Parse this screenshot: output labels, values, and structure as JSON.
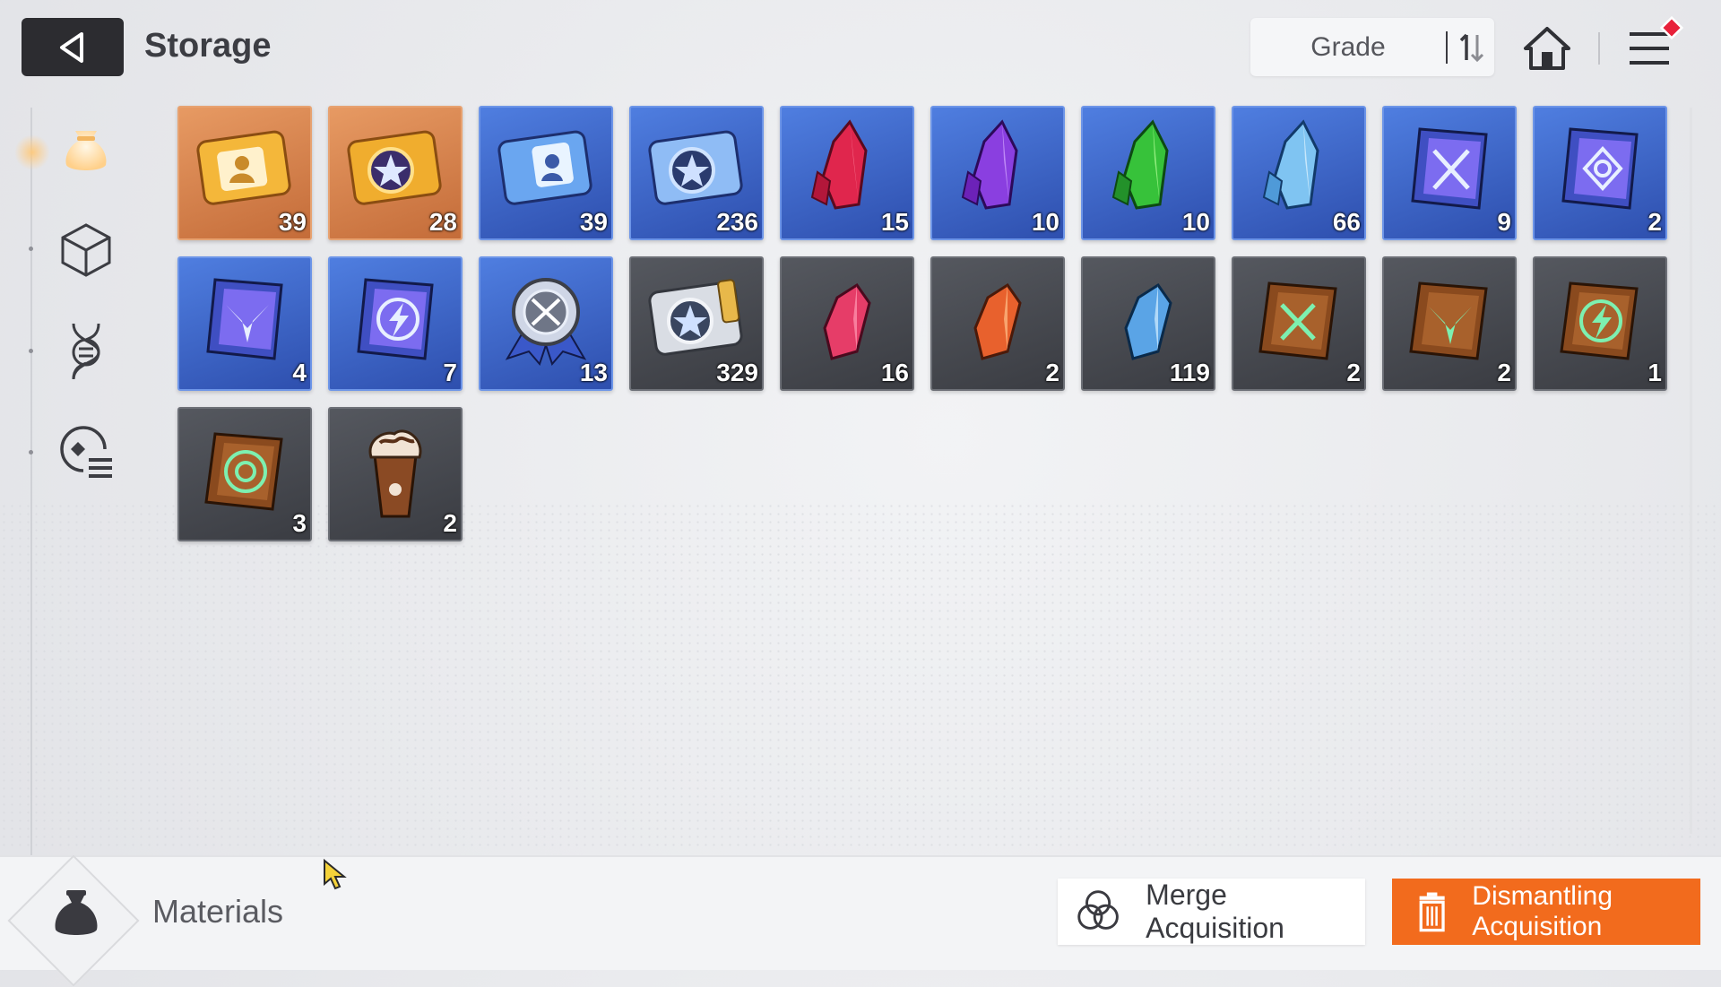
{
  "header": {
    "title": "Storage",
    "sort_label": "Grade"
  },
  "colors": {
    "accent": "#f26b1d",
    "notification": "#e8213a",
    "tile_orange": "#d98250",
    "tile_blue": "#3d66c9",
    "tile_gray": "#484a50"
  },
  "sidebar": {
    "tabs": [
      {
        "icon": "material-bag-icon",
        "active": true
      },
      {
        "icon": "cube-icon",
        "active": false
      },
      {
        "icon": "dna-icon",
        "active": false
      },
      {
        "icon": "character-list-icon",
        "active": false
      }
    ]
  },
  "items": [
    {
      "icon": "gold-character-ticket-icon",
      "qty": "39"
    },
    {
      "icon": "gold-star-ticket-icon",
      "qty": "28"
    },
    {
      "icon": "blue-character-ticket-icon",
      "qty": "39"
    },
    {
      "icon": "blue-star-ticket-icon",
      "qty": "236"
    },
    {
      "icon": "red-crystal-icon",
      "qty": "15"
    },
    {
      "icon": "purple-crystal-icon",
      "qty": "10"
    },
    {
      "icon": "green-crystal-icon",
      "qty": "10"
    },
    {
      "icon": "blue-crystal-icon",
      "qty": "66"
    },
    {
      "icon": "blue-sword-book-icon",
      "qty": "9"
    },
    {
      "icon": "blue-eye-book-icon",
      "qty": "2"
    },
    {
      "icon": "blue-wing-book-icon",
      "qty": "4"
    },
    {
      "icon": "blue-bolt-book-icon",
      "qty": "7"
    },
    {
      "icon": "medal-badge-icon",
      "qty": "13"
    },
    {
      "icon": "silver-star-ticket-icon",
      "qty": "329"
    },
    {
      "icon": "red-shard-icon",
      "qty": "16"
    },
    {
      "icon": "orange-shard-icon",
      "qty": "2"
    },
    {
      "icon": "blue-shard-icon",
      "qty": "119"
    },
    {
      "icon": "brown-sword-book-icon",
      "qty": "2"
    },
    {
      "icon": "brown-wing-book-icon",
      "qty": "2"
    },
    {
      "icon": "brown-bolt-book-icon",
      "qty": "1"
    },
    {
      "icon": "brown-eye-book-icon",
      "qty": "3"
    },
    {
      "icon": "chocolate-frappe-icon",
      "qty": "2"
    }
  ],
  "footer": {
    "category_label": "Materials",
    "merge_label": "Merge Acquisition",
    "dismantle_label": "Dismantling Acquisition"
  }
}
